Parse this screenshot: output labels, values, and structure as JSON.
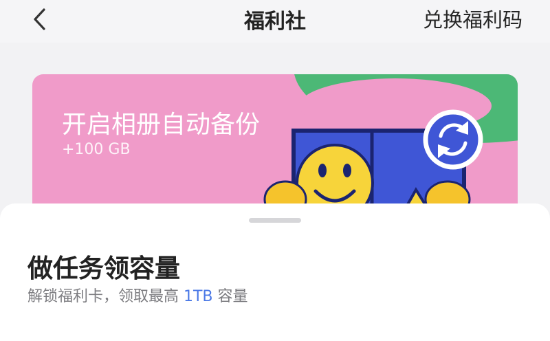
{
  "header": {
    "title": "福利社",
    "redeem_label": "兑换福利码"
  },
  "promo_card": {
    "title": "开启相册自动备份",
    "reward": "+100 GB"
  },
  "bottom_sheet": {
    "title": "做任务领容量",
    "subtitle_prefix": "解锁福利卡，领取最高 ",
    "subtitle_highlight": "1TB",
    "subtitle_suffix": " 容量"
  },
  "colors": {
    "card_pink": "#f09bc9",
    "card_green": "#4cb876",
    "album_blue": "#3f56d6",
    "smiley_yellow": "#f7d43a",
    "accent_blue": "#4a78e6"
  }
}
